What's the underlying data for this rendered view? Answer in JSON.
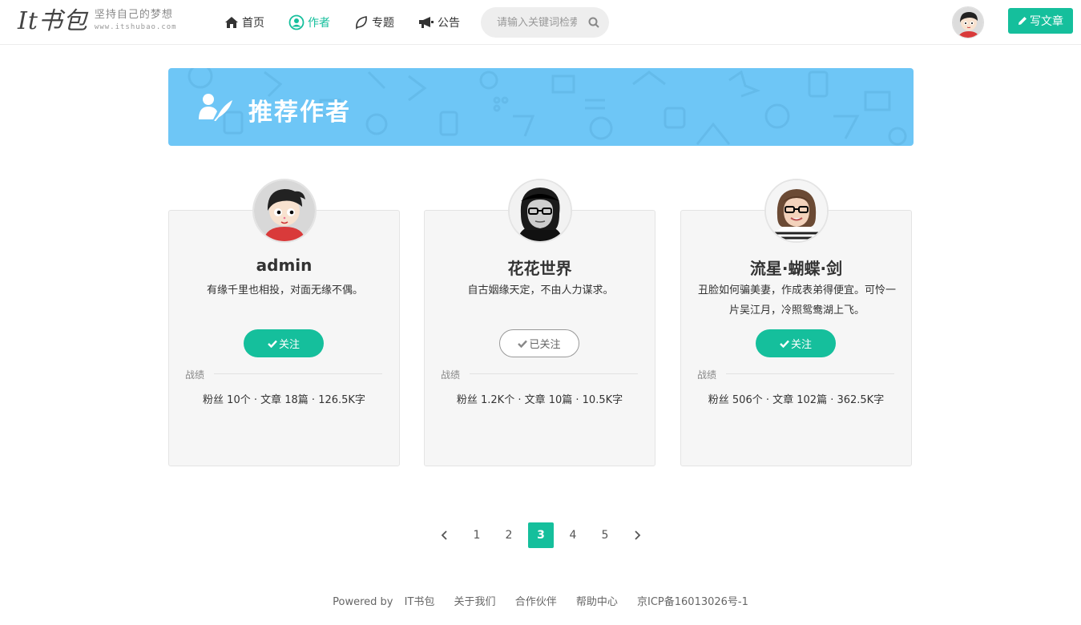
{
  "header": {
    "logo_mark": "It书包",
    "slogan": "坚持自己的梦想",
    "url": "www.itshubao.com",
    "nav": [
      {
        "label": "首页",
        "icon": "home-icon",
        "active": false
      },
      {
        "label": "作者",
        "icon": "user-circle-icon",
        "active": true
      },
      {
        "label": "专题",
        "icon": "leaf-icon",
        "active": false
      },
      {
        "label": "公告",
        "icon": "megaphone-icon",
        "active": false
      }
    ],
    "search_placeholder": "请输入关键词检索",
    "write_label": "写文章"
  },
  "banner": {
    "title": "推荐作者"
  },
  "stats_label": "战绩",
  "authors": [
    {
      "name": "admin",
      "bio": "有缘千里也相投，对面无缘不偶。",
      "follow_label": "关注",
      "followed": false,
      "stats": "粉丝 10个 · 文章 18篇 · 126.5K字"
    },
    {
      "name": "花花世界",
      "bio": "自古姻缘天定，不由人力谋求。",
      "follow_label": "已关注",
      "followed": true,
      "stats": "粉丝 1.2K个 · 文章 10篇 · 10.5K字"
    },
    {
      "name": "流星·蝴蝶·剑",
      "bio": "丑脸如何骗美妻，作成表弟得便宜。可怜一片吴江月，冷照鸳鸯湖上飞。",
      "follow_label": "关注",
      "followed": false,
      "stats": "粉丝 506个 · 文章 102篇 · 362.5K字"
    }
  ],
  "pagination": {
    "pages": [
      "1",
      "2",
      "3",
      "4",
      "5"
    ],
    "current": "3",
    "prev_icon": "chevron-left-icon",
    "next_icon": "chevron-right-icon"
  },
  "footer": {
    "powered": "Powered by",
    "links": [
      "IT书包",
      "关于我们",
      "合作伙伴",
      "帮助中心",
      "京ICP备16013026号-1"
    ]
  },
  "colors": {
    "accent": "#15bf9c",
    "banner": "#6ec6f6"
  }
}
